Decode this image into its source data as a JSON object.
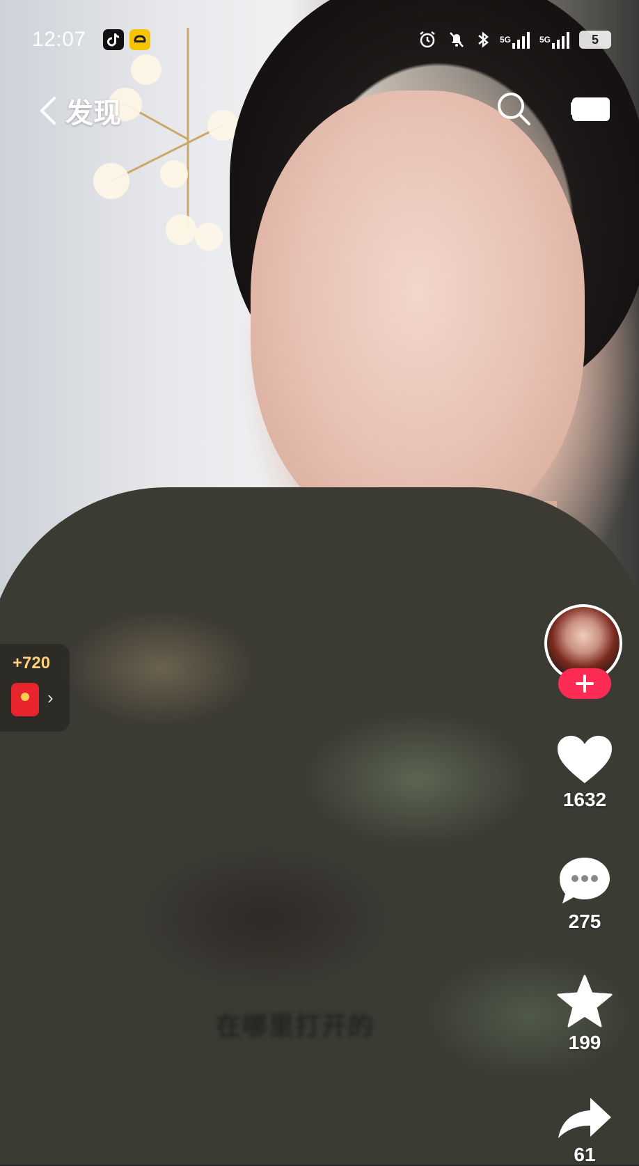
{
  "status_bar": {
    "time": "12:07",
    "battery": "5",
    "network_1": "5G",
    "network_2": "5G"
  },
  "nav": {
    "title": "发现"
  },
  "actions": {
    "like_count": "1632",
    "comment_count": "275",
    "favorite_count": "199",
    "share_count": "61"
  },
  "red_packet": {
    "amount": "+720",
    "chevron": "›"
  },
  "subtitle": "在哪里打开的",
  "colors": {
    "follow_button": "#fe2c55",
    "red_packet_amount": "#ffd27a"
  }
}
